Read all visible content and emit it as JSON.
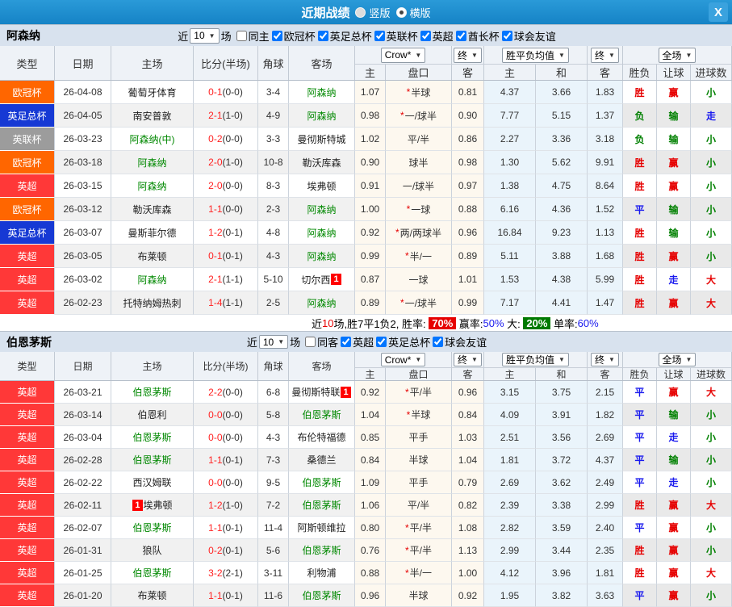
{
  "titlebar": {
    "title": "近期战绩",
    "radios": [
      {
        "label": "竖版",
        "selected": false
      },
      {
        "label": "横版",
        "selected": true
      }
    ],
    "close_icon": "X"
  },
  "type_colors": {
    "欧冠杯": "#ff6600",
    "英足总杯": "#1639d4",
    "英联杯": "#9c9c9c",
    "英超": "#ff3838"
  },
  "columns": [
    "类型",
    "日期",
    "主场",
    "比分(半场)",
    "角球",
    "客场"
  ],
  "subcolumns": [
    "主",
    "盘口",
    "客",
    "主",
    "和",
    "客",
    "胜负",
    "让球",
    "进球数"
  ],
  "sections": [
    {
      "team": "阿森纳",
      "filter": {
        "near": "近",
        "count": "10",
        "unit": "场",
        "same_label": "同主",
        "same_checked": false,
        "comps": [
          {
            "label": "欧冠杯",
            "checked": true
          },
          {
            "label": "英足总杯",
            "checked": true
          },
          {
            "label": "英联杯",
            "checked": true
          },
          {
            "label": "英超",
            "checked": true
          },
          {
            "label": "酋长杯",
            "checked": true
          },
          {
            "label": "球会友谊",
            "checked": true
          }
        ]
      },
      "dropdowns": [
        "Crow*",
        "终",
        "胜平负均值",
        "终",
        "全场"
      ],
      "rows": [
        {
          "type": "欧冠杯",
          "date": "26-04-08",
          "home": "葡萄牙体育",
          "home_green": false,
          "home_badge": null,
          "score": "0-1",
          "half": "(0-0)",
          "corners": "3-4",
          "away": "阿森纳",
          "away_green": true,
          "away_badge": null,
          "o1": "1.07",
          "pan": "*半球",
          "o2": "0.81",
          "m1": "4.37",
          "m2": "3.66",
          "m3": "1.83",
          "r1": "胜",
          "r2": "赢",
          "r3": "小"
        },
        {
          "type": "英足总杯",
          "date": "26-04-05",
          "home": "南安普敦",
          "home_green": false,
          "home_badge": null,
          "score": "2-1",
          "half": "(1-0)",
          "corners": "4-9",
          "away": "阿森纳",
          "away_green": true,
          "away_badge": null,
          "o1": "0.98",
          "pan": "*一/球半",
          "o2": "0.90",
          "m1": "7.77",
          "m2": "5.15",
          "m3": "1.37",
          "r1": "负",
          "r2": "输",
          "r3": "走"
        },
        {
          "type": "英联杯",
          "date": "26-03-23",
          "home": "阿森纳(中)",
          "home_green": true,
          "home_badge": null,
          "score": "0-2",
          "half": "(0-0)",
          "corners": "3-3",
          "away": "曼彻斯特城",
          "away_green": false,
          "away_badge": null,
          "o1": "1.02",
          "pan": "平/半",
          "o2": "0.86",
          "m1": "2.27",
          "m2": "3.36",
          "m3": "3.18",
          "r1": "负",
          "r2": "输",
          "r3": "小"
        },
        {
          "type": "欧冠杯",
          "date": "26-03-18",
          "home": "阿森纳",
          "home_green": true,
          "home_badge": null,
          "score": "2-0",
          "half": "(1-0)",
          "corners": "10-8",
          "away": "勒沃库森",
          "away_green": false,
          "away_badge": null,
          "o1": "0.90",
          "pan": "球半",
          "o2": "0.98",
          "m1": "1.30",
          "m2": "5.62",
          "m3": "9.91",
          "r1": "胜",
          "r2": "赢",
          "r3": "小"
        },
        {
          "type": "英超",
          "date": "26-03-15",
          "home": "阿森纳",
          "home_green": true,
          "home_badge": null,
          "score": "2-0",
          "half": "(0-0)",
          "corners": "8-3",
          "away": "埃弗顿",
          "away_green": false,
          "away_badge": null,
          "o1": "0.91",
          "pan": "一/球半",
          "o2": "0.97",
          "m1": "1.38",
          "m2": "4.75",
          "m3": "8.64",
          "r1": "胜",
          "r2": "赢",
          "r3": "小"
        },
        {
          "type": "欧冠杯",
          "date": "26-03-12",
          "home": "勒沃库森",
          "home_green": false,
          "home_badge": null,
          "score": "1-1",
          "half": "(0-0)",
          "corners": "2-3",
          "away": "阿森纳",
          "away_green": true,
          "away_badge": null,
          "o1": "1.00",
          "pan": "*一球",
          "o2": "0.88",
          "m1": "6.16",
          "m2": "4.36",
          "m3": "1.52",
          "r1": "平",
          "r2": "输",
          "r3": "小"
        },
        {
          "type": "英足总杯",
          "date": "26-03-07",
          "home": "曼斯菲尔德",
          "home_green": false,
          "home_badge": null,
          "score": "1-2",
          "half": "(0-1)",
          "corners": "4-8",
          "away": "阿森纳",
          "away_green": true,
          "away_badge": null,
          "o1": "0.92",
          "pan": "*两/两球半",
          "o2": "0.96",
          "m1": "16.84",
          "m2": "9.23",
          "m3": "1.13",
          "r1": "胜",
          "r2": "输",
          "r3": "小"
        },
        {
          "type": "英超",
          "date": "26-03-05",
          "home": "布莱顿",
          "home_green": false,
          "home_badge": null,
          "score": "0-1",
          "half": "(0-1)",
          "corners": "4-3",
          "away": "阿森纳",
          "away_green": true,
          "away_badge": null,
          "o1": "0.99",
          "pan": "*半/一",
          "o2": "0.89",
          "m1": "5.11",
          "m2": "3.88",
          "m3": "1.68",
          "r1": "胜",
          "r2": "赢",
          "r3": "小"
        },
        {
          "type": "英超",
          "date": "26-03-02",
          "home": "阿森纳",
          "home_green": true,
          "home_badge": null,
          "score": "2-1",
          "half": "(1-1)",
          "corners": "5-10",
          "away": "切尔西",
          "away_green": false,
          "away_badge": {
            "text": "1",
            "pos": "after"
          },
          "o1": "0.87",
          "pan": "一球",
          "o2": "1.01",
          "m1": "1.53",
          "m2": "4.38",
          "m3": "5.99",
          "r1": "胜",
          "r2": "走",
          "r3": "大"
        },
        {
          "type": "英超",
          "date": "26-02-23",
          "home": "托特纳姆热刺",
          "home_green": false,
          "home_badge": null,
          "score": "1-4",
          "half": "(1-1)",
          "corners": "2-5",
          "away": "阿森纳",
          "away_green": true,
          "away_badge": null,
          "o1": "0.89",
          "pan": "*一/球半",
          "o2": "0.99",
          "m1": "7.17",
          "m2": "4.41",
          "m3": "1.47",
          "r1": "胜",
          "r2": "赢",
          "r3": "大"
        }
      ],
      "summary_parts": [
        {
          "t": "近",
          "c": "plain"
        },
        {
          "t": "10",
          "c": "red"
        },
        {
          "t": "场,胜7平1负2, 胜率: ",
          "c": "plain"
        },
        {
          "t": "70%",
          "c": "red-badge"
        },
        {
          "t": " 赢率:",
          "c": "plain"
        },
        {
          "t": "50%",
          "c": "blue"
        },
        {
          "t": " 大: ",
          "c": "plain"
        },
        {
          "t": "20%",
          "c": "green-badge"
        },
        {
          "t": " 单率:",
          "c": "plain"
        },
        {
          "t": "60%",
          "c": "blue"
        }
      ]
    },
    {
      "team": "伯恩茅斯",
      "filter": {
        "near": "近",
        "count": "10",
        "unit": "场",
        "same_label": "同客",
        "same_checked": false,
        "comps": [
          {
            "label": "英超",
            "checked": true
          },
          {
            "label": "英足总杯",
            "checked": true
          },
          {
            "label": "球会友谊",
            "checked": true
          }
        ]
      },
      "dropdowns": [
        "Crow*",
        "终",
        "胜平负均值",
        "终",
        "全场"
      ],
      "rows": [
        {
          "type": "英超",
          "date": "26-03-21",
          "home": "伯恩茅斯",
          "home_green": true,
          "home_badge": null,
          "score": "2-2",
          "half": "(0-0)",
          "corners": "6-8",
          "away": "曼彻斯特联",
          "away_green": false,
          "away_badge": {
            "text": "1",
            "pos": "after"
          },
          "o1": "0.92",
          "pan": "*平/半",
          "o2": "0.96",
          "m1": "3.15",
          "m2": "3.75",
          "m3": "2.15",
          "r1": "平",
          "r2": "赢",
          "r3": "大"
        },
        {
          "type": "英超",
          "date": "26-03-14",
          "home": "伯恩利",
          "home_green": false,
          "home_badge": null,
          "score": "0-0",
          "half": "(0-0)",
          "corners": "5-8",
          "away": "伯恩茅斯",
          "away_green": true,
          "away_badge": null,
          "o1": "1.04",
          "pan": "*半球",
          "o2": "0.84",
          "m1": "4.09",
          "m2": "3.91",
          "m3": "1.82",
          "r1": "平",
          "r2": "输",
          "r3": "小"
        },
        {
          "type": "英超",
          "date": "26-03-04",
          "home": "伯恩茅斯",
          "home_green": true,
          "home_badge": null,
          "score": "0-0",
          "half": "(0-0)",
          "corners": "4-3",
          "away": "布伦特福德",
          "away_green": false,
          "away_badge": null,
          "o1": "0.85",
          "pan": "平手",
          "o2": "1.03",
          "m1": "2.51",
          "m2": "3.56",
          "m3": "2.69",
          "r1": "平",
          "r2": "走",
          "r3": "小"
        },
        {
          "type": "英超",
          "date": "26-02-28",
          "home": "伯恩茅斯",
          "home_green": true,
          "home_badge": null,
          "score": "1-1",
          "half": "(0-1)",
          "corners": "7-3",
          "away": "桑德兰",
          "away_green": false,
          "away_badge": null,
          "o1": "0.84",
          "pan": "半球",
          "o2": "1.04",
          "m1": "1.81",
          "m2": "3.72",
          "m3": "4.37",
          "r1": "平",
          "r2": "输",
          "r3": "小"
        },
        {
          "type": "英超",
          "date": "26-02-22",
          "home": "西汉姆联",
          "home_green": false,
          "home_badge": null,
          "score": "0-0",
          "half": "(0-0)",
          "corners": "9-5",
          "away": "伯恩茅斯",
          "away_green": true,
          "away_badge": null,
          "o1": "1.09",
          "pan": "平手",
          "o2": "0.79",
          "m1": "2.69",
          "m2": "3.62",
          "m3": "2.49",
          "r1": "平",
          "r2": "走",
          "r3": "小"
        },
        {
          "type": "英超",
          "date": "26-02-11",
          "home": "埃弗顿",
          "home_green": false,
          "home_badge": {
            "text": "1",
            "pos": "before"
          },
          "score": "1-2",
          "half": "(1-0)",
          "corners": "7-2",
          "away": "伯恩茅斯",
          "away_green": true,
          "away_badge": null,
          "o1": "1.06",
          "pan": "平/半",
          "o2": "0.82",
          "m1": "2.39",
          "m2": "3.38",
          "m3": "2.99",
          "r1": "胜",
          "r2": "赢",
          "r3": "大"
        },
        {
          "type": "英超",
          "date": "26-02-07",
          "home": "伯恩茅斯",
          "home_green": true,
          "home_badge": null,
          "score": "1-1",
          "half": "(0-1)",
          "corners": "11-4",
          "away": "阿斯顿维拉",
          "away_green": false,
          "away_badge": null,
          "o1": "0.80",
          "pan": "*平/半",
          "o2": "1.08",
          "m1": "2.82",
          "m2": "3.59",
          "m3": "2.40",
          "r1": "平",
          "r2": "赢",
          "r3": "小"
        },
        {
          "type": "英超",
          "date": "26-01-31",
          "home": "狼队",
          "home_green": false,
          "home_badge": null,
          "score": "0-2",
          "half": "(0-1)",
          "corners": "5-6",
          "away": "伯恩茅斯",
          "away_green": true,
          "away_badge": null,
          "o1": "0.76",
          "pan": "*平/半",
          "o2": "1.13",
          "m1": "2.99",
          "m2": "3.44",
          "m3": "2.35",
          "r1": "胜",
          "r2": "赢",
          "r3": "小"
        },
        {
          "type": "英超",
          "date": "26-01-25",
          "home": "伯恩茅斯",
          "home_green": true,
          "home_badge": null,
          "score": "3-2",
          "half": "(2-1)",
          "corners": "3-11",
          "away": "利物浦",
          "away_green": false,
          "away_badge": null,
          "o1": "0.88",
          "pan": "*半/一",
          "o2": "1.00",
          "m1": "4.12",
          "m2": "3.96",
          "m3": "1.81",
          "r1": "胜",
          "r2": "赢",
          "r3": "大"
        },
        {
          "type": "英超",
          "date": "26-01-20",
          "home": "布莱顿",
          "home_green": false,
          "home_badge": null,
          "score": "1-1",
          "half": "(0-1)",
          "corners": "11-6",
          "away": "伯恩茅斯",
          "away_green": true,
          "away_badge": null,
          "o1": "0.96",
          "pan": "半球",
          "o2": "0.92",
          "m1": "1.95",
          "m2": "3.82",
          "m3": "3.63",
          "r1": "平",
          "r2": "赢",
          "r3": "小"
        }
      ],
      "summary_parts": null
    }
  ]
}
